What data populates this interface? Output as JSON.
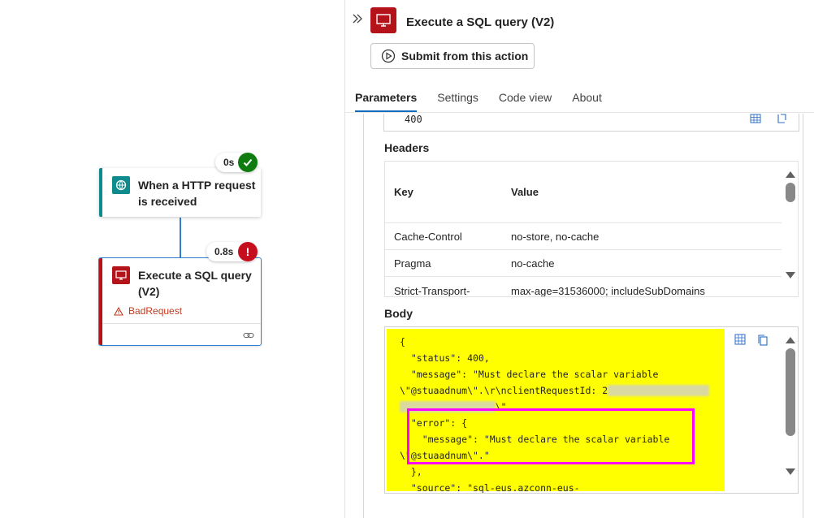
{
  "canvas": {
    "http_node": {
      "title": "When a HTTP request is received",
      "duration": "0s"
    },
    "sql_node": {
      "title": "Execute a SQL query (V2)",
      "duration": "0.8s",
      "error_label": "BadRequest"
    }
  },
  "panel": {
    "title": "Execute a SQL query (V2)",
    "submit_label": "Submit from this action",
    "tabs": [
      {
        "label": "Parameters",
        "active": true
      },
      {
        "label": "Settings",
        "active": false
      },
      {
        "label": "Code view",
        "active": false
      },
      {
        "label": "About",
        "active": false
      }
    ],
    "status_code_value": "400",
    "headers_label": "Headers",
    "headers": {
      "col_key": "Key",
      "col_value": "Value",
      "rows": [
        {
          "key": "Cache-Control",
          "value": "no-store, no-cache"
        },
        {
          "key": "Pragma",
          "value": "no-cache"
        },
        {
          "key": "Strict-Transport-Security",
          "value": "max-age=31536000; includeSubDomains"
        }
      ]
    },
    "body_label": "Body",
    "body_lines": [
      "{",
      "  \"status\": 400,",
      "  \"message\": \"Must declare the scalar variable",
      "\\\"@stuaadnum\\\".\\r\\nclientRequestId: 2",
      "\\\"",
      "  \"error\": {",
      "    \"message\": \"Must declare the scalar variable",
      "\\\"@stuaadnum\\\".\"",
      "  },",
      "  \"source\": \"sql-eus.azconn-eus-"
    ]
  },
  "colors": {
    "accent": "#0f6cbd",
    "http_teal": "#0f8b8d",
    "sql_red": "#b4131a",
    "success": "#107c10",
    "error": "#c50f1f",
    "highlight_yellow": "#ffff00",
    "highlight_magenta": "#ff00ff"
  }
}
